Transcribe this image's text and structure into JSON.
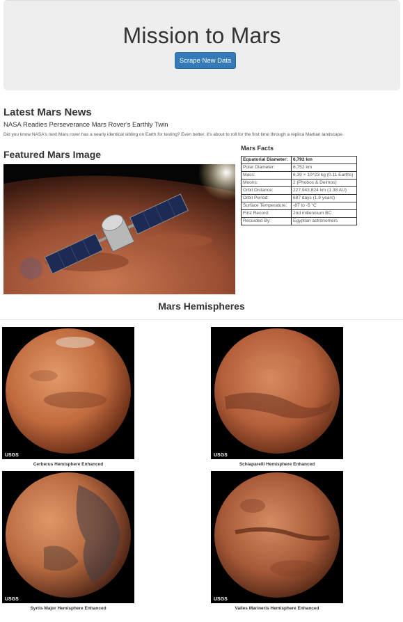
{
  "header": {
    "title": "Mission to Mars",
    "scrape_button": "Scrape New Data"
  },
  "news": {
    "heading": "Latest Mars News",
    "title": "NASA Readies Perseverance Mars Rover's Earthly Twin",
    "paragraph": "Did you know NASA's next Mars rover has a nearly identical sibling on Earth for testing? Even better, it's about to roll for the first time through a replica Martian landscape."
  },
  "featured": {
    "heading": "Featured Mars Image",
    "image_icon": "spacecraft-over-mars-image"
  },
  "facts": {
    "heading": "Mars Facts",
    "rows": [
      {
        "label": "Equatorial Diameter:",
        "value": "6,792 km"
      },
      {
        "label": "Polar Diameter:",
        "value": "6,752 km"
      },
      {
        "label": "Mass:",
        "value": "6.39 × 10^23 kg (0.11 Earths)"
      },
      {
        "label": "Moons:",
        "value": "2 (Phobos & Deimos)"
      },
      {
        "label": "Orbit Distance:",
        "value": "227,943,824 km (1.38 AU)"
      },
      {
        "label": "Orbit Period:",
        "value": "687 days (1.9 years)"
      },
      {
        "label": "Surface Temperature:",
        "value": "-87 to -5 °C"
      },
      {
        "label": "First Record:",
        "value": "2nd millennium BC"
      },
      {
        "label": "Recorded By:",
        "value": "Egyptian astronomers"
      }
    ]
  },
  "hemispheres": {
    "heading": "Mars Hemispheres",
    "logo_text": "USGS",
    "items": [
      {
        "caption": "Cerberus Hemisphere Enhanced",
        "image_icon": "mars-globe-image"
      },
      {
        "caption": "Schiaparelli Hemisphere Enhanced",
        "image_icon": "mars-globe-image"
      },
      {
        "caption": "Syrtis Major Hemisphere Enhanced",
        "image_icon": "mars-globe-image"
      },
      {
        "caption": "Valles Marineris Hemisphere Enhanced",
        "image_icon": "mars-globe-image"
      }
    ]
  },
  "colors": {
    "button": "#337ab7",
    "jumbotron": "#eeeeee"
  }
}
